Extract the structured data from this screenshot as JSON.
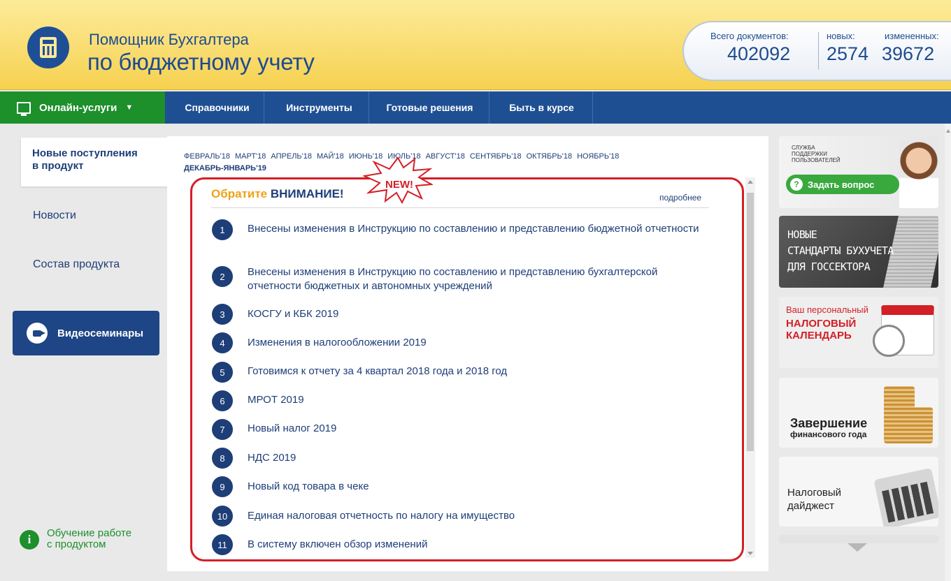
{
  "header": {
    "title_line1": "Помощник Бухгалтера",
    "title_line2": "по бюджетному учету",
    "stats": [
      {
        "label": "Всего документов:",
        "value": "402092"
      },
      {
        "label": "новых:",
        "value": "2574"
      },
      {
        "label": "измененных:",
        "value": "39672"
      }
    ]
  },
  "nav": {
    "online": "Онлайн-услуги",
    "items": [
      "Справочники",
      "Инструменты",
      "Готовые решения",
      "Быть в курсе"
    ]
  },
  "sidebar": {
    "active_line1": "Новые поступления",
    "active_line2": "в продукт",
    "links": [
      "Новости",
      "Состав продукта"
    ],
    "video_button": "Видеосеминары",
    "learn_line1": "Обучение работе",
    "learn_line2": "с продуктом"
  },
  "main": {
    "months": [
      "ФЕВРАЛЬ'18",
      "МАРТ'18",
      "АПРЕЛЬ'18",
      "МАЙ'18",
      "ИЮНЬ'18",
      "ИЮЛЬ'18",
      "АВГУСТ'18",
      "СЕНТЯБРЬ'18",
      "ОКТЯБРЬ'18",
      "НОЯБРЬ'18"
    ],
    "current_month": "ДЕКАБРЬ-ЯНВАРЬ'19",
    "badge": "NEW!",
    "attention_prefix": "Обратите",
    "attention_word": "ВНИМАНИЕ!",
    "more_link": "подробнее",
    "items": [
      {
        "n": "1",
        "text": "Внесены изменения в Инструкцию по составлению и представлению бюджетной отчетности"
      },
      {
        "n": "2",
        "text": "Внесены изменения в Инструкцию по составлению и представлению бухгалтерской отчетности бюджетных и автономных учреждений"
      },
      {
        "n": "3",
        "text": "КОСГУ и КБК 2019"
      },
      {
        "n": "4",
        "text": "Изменения в налогообложении 2019"
      },
      {
        "n": "5",
        "text": "Готовимся к отчету за 4 квартал 2018 года и 2018 год"
      },
      {
        "n": "6",
        "text": "МРОТ 2019"
      },
      {
        "n": "7",
        "text": "Новый налог 2019"
      },
      {
        "n": "8",
        "text": "НДС 2019"
      },
      {
        "n": "9",
        "text": "Новый код товара в чеке"
      },
      {
        "n": "10",
        "text": "Единая налоговая отчетность по налогу на имущество"
      },
      {
        "n": "11",
        "text": "В систему включен обзор изменений"
      }
    ]
  },
  "banners": {
    "support_small": "СЛУЖБА ПОДДЕРЖКИ ПОЛЬЗОВАТЕЛЕЙ",
    "support_button": "Задать вопрос",
    "standards": "НОВЫЕ СТАНДАРТЫ БУХУЧЕТА ДЛЯ ГОССЕКТОРА",
    "standards_l1": "НОВЫЕ",
    "standards_l2": "СТАНДАРТЫ БУХУЧЕТА",
    "standards_l3": "ДЛЯ ГОССЕКТОРА",
    "calendar_l1": "Ваш персональный",
    "calendar_l2": "НАЛОГОВЫЙ",
    "calendar_l3": "КАЛЕНДАРЬ",
    "year_end_l1": "Завершение",
    "year_end_l2": "финансового года",
    "digest_l1": "Налоговый",
    "digest_l2": "дайджест"
  }
}
